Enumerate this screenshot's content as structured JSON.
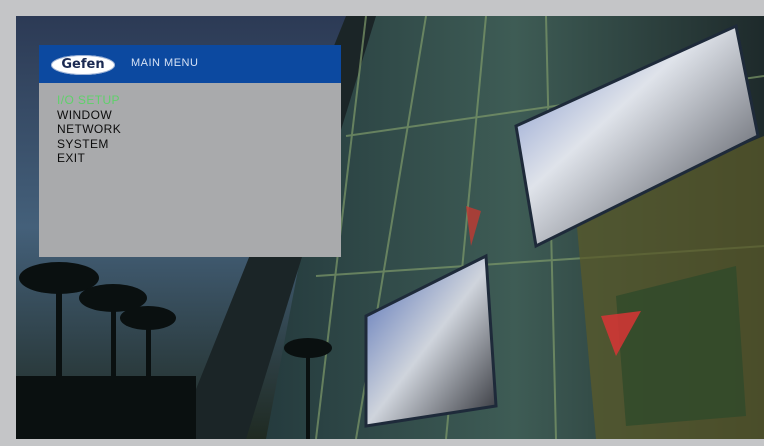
{
  "header": {
    "logo_text": "Gefen",
    "title": "MAIN MENU"
  },
  "menu": {
    "items": [
      {
        "label": "I/O SETUP",
        "selected": true
      },
      {
        "label": "WINDOW",
        "selected": false
      },
      {
        "label": "NETWORK",
        "selected": false
      },
      {
        "label": "SYSTEM",
        "selected": false
      },
      {
        "label": "EXIT",
        "selected": false
      }
    ],
    "selected_color": "#5fd16a"
  },
  "colors": {
    "header_bar": "#0c49a0",
    "menu_panel": "#a9aaac",
    "frame": "#c4c5c7"
  }
}
